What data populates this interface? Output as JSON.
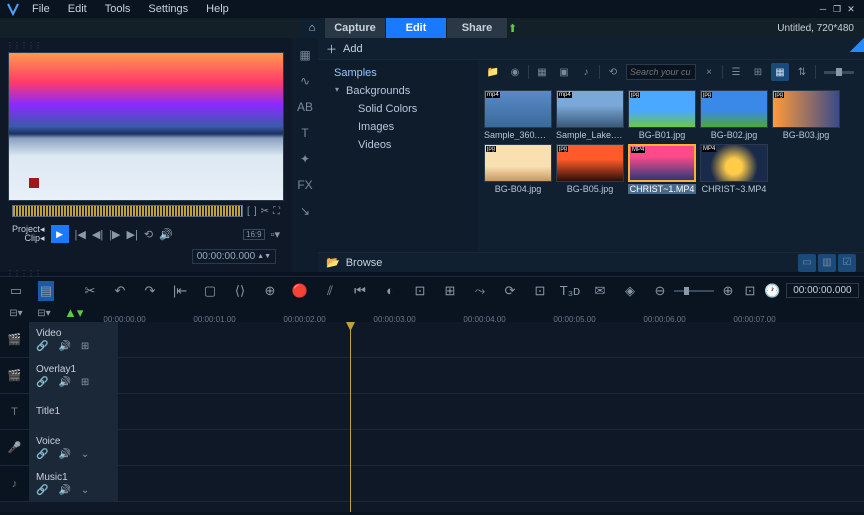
{
  "menu": {
    "file": "File",
    "edit": "Edit",
    "tools": "Tools",
    "settings": "Settings",
    "help": "Help"
  },
  "tabs": {
    "capture": "Capture",
    "edit": "Edit",
    "share": "Share"
  },
  "project": {
    "title": "Untitled, 720*480"
  },
  "lib": {
    "add": "Add",
    "browse": "Browse",
    "search_placeholder": "Search your cu",
    "tree": {
      "samples": "Samples",
      "backgrounds": "Backgrounds",
      "solid": "Solid Colors",
      "images": "Images",
      "videos": "Videos"
    },
    "thumbs": [
      {
        "label": "Sample_360.mp4",
        "badge": "mp4"
      },
      {
        "label": "Sample_Lake.m...",
        "badge": "mp4"
      },
      {
        "label": "BG-B01.jpg",
        "badge": "jpg"
      },
      {
        "label": "BG-B02.jpg",
        "badge": "jpg"
      },
      {
        "label": "BG-B03.jpg",
        "badge": "jpg"
      },
      {
        "label": "BG-B04.jpg",
        "badge": "jpg"
      },
      {
        "label": "BG-B05.jpg",
        "badge": "jpg"
      },
      {
        "label": "CHRIST~1.MP4",
        "badge": "MP4"
      },
      {
        "label": "CHRIST~3.MP4",
        "badge": "MP4"
      }
    ]
  },
  "playback": {
    "project": "Project",
    "clip": "Clip",
    "ratio": "16:9"
  },
  "timecode": {
    "preview": "00:00:00.000",
    "timeline": "00:00:00.000"
  },
  "ruler": [
    "00:00:00.00",
    "00:00:01.00",
    "00:00:02.00",
    "00:00:03.00",
    "00:00:04.00",
    "00:00:05.00",
    "00:00:06.00",
    "00:00:07.00"
  ],
  "tracks": {
    "video": "Video",
    "overlay": "Overlay1",
    "title": "Title1",
    "voice": "Voice",
    "music": "Music1"
  }
}
